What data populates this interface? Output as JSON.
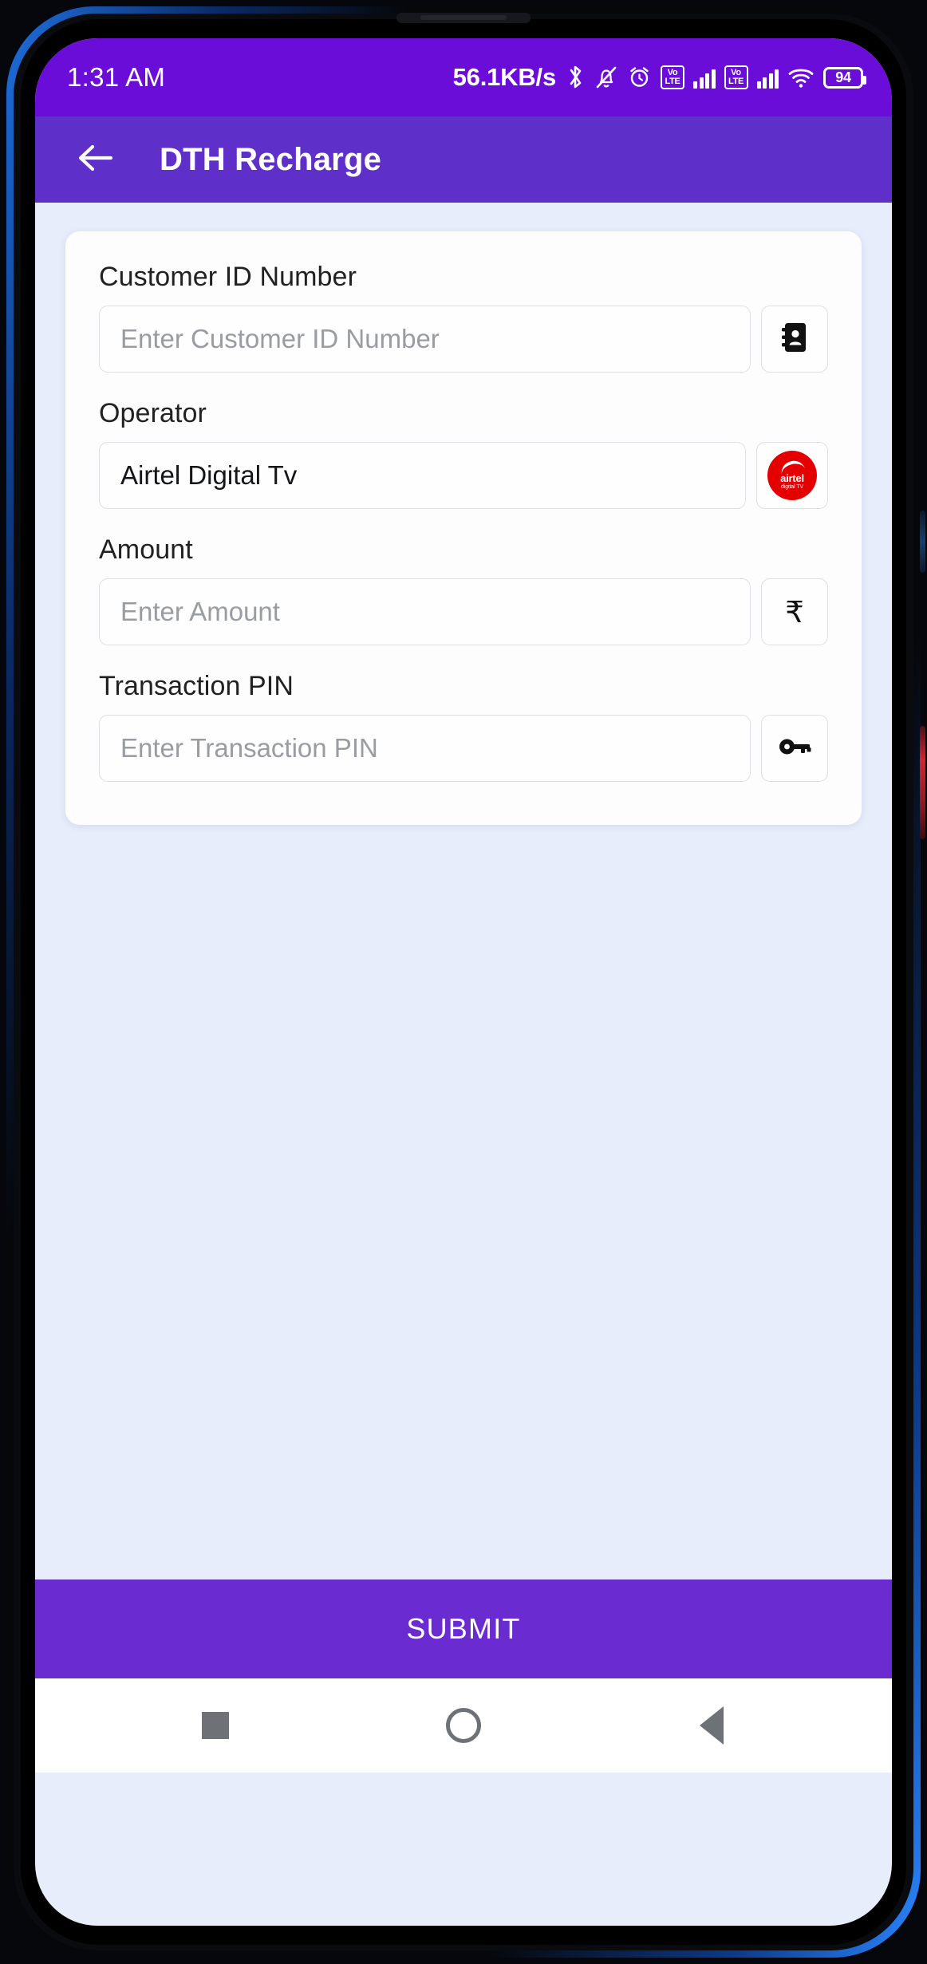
{
  "status_bar": {
    "time": "1:31 AM",
    "network_speed": "56.1KB/s",
    "battery_level": "94",
    "icons": [
      "bluetooth-icon",
      "silent-bell-icon",
      "alarm-clock-icon",
      "volte-icon",
      "signal-bars-icon",
      "volte-icon",
      "signal-bars-icon",
      "wifi-icon",
      "battery-icon"
    ],
    "volte_top": "Vo",
    "volte_bottom": "LTE",
    "background_color": "#6A0DD9"
  },
  "app_bar": {
    "back_icon": "arrow-left-icon",
    "title": "DTH Recharge",
    "background_color": "#5E2FC9"
  },
  "form": {
    "fields": [
      {
        "label": "Customer ID Number",
        "placeholder": "Enter Customer ID Number",
        "value": "",
        "icon": "contact-book-icon"
      },
      {
        "label": "Operator",
        "placeholder": "",
        "value": "Airtel Digital Tv",
        "icon": "airtel-digital-tv-logo"
      },
      {
        "label": "Amount",
        "placeholder": "Enter Amount",
        "value": "",
        "icon": "rupee-icon"
      },
      {
        "label": "Transaction PIN",
        "placeholder": "Enter Transaction PIN",
        "value": "",
        "icon": "key-icon"
      }
    ]
  },
  "operator_logo": {
    "brand": "airtel",
    "sub": "digital TV",
    "color": "#E40000"
  },
  "rupee_symbol": "₹",
  "submit": {
    "label": "SUBMIT",
    "background_color": "#6A2BD0"
  },
  "nav_bar": {
    "recents_icon": "square-icon",
    "home_icon": "circle-icon",
    "back_icon": "triangle-back-icon"
  },
  "theme": {
    "page_background": "#E8EDFB",
    "card_background": "#FDFDFE",
    "accent": "#6A2BD0"
  }
}
